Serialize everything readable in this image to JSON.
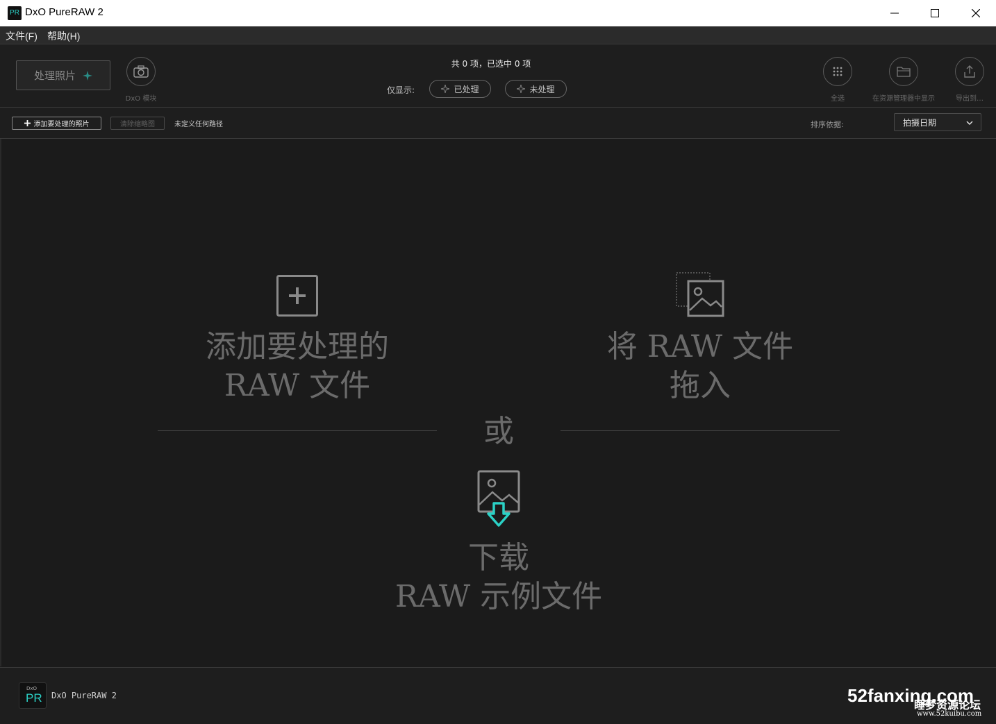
{
  "window": {
    "icon_text": "PR",
    "title": "DxO PureRAW 2"
  },
  "menu": [
    {
      "label": "文件(F)"
    },
    {
      "label": "帮助(H)"
    }
  ],
  "toolbar": {
    "process_label": "处理照片",
    "module_label": "DxO 模块",
    "count_text": "共 0 项，已选中 0 项",
    "filter_label": "仅显示:",
    "filter_processed": "已处理",
    "filter_unprocessed": "未处理",
    "select_all_label": "全选",
    "show_in_explorer_label": "在资源管理器中显示",
    "export_label": "导出到…"
  },
  "secondary": {
    "add_label": "添加要处理的照片",
    "clear_label": "清除缩略图",
    "path_text": "未定义任何路径",
    "sort_label": "排序依据:",
    "sort_value": "拍摄日期"
  },
  "main": {
    "add_text": "添加要处理的\nRAW 文件",
    "drag_text": "将 RAW 文件\n拖入",
    "or_text": "或",
    "download_text": "下载\nRAW 示例文件"
  },
  "footer": {
    "logo_small": "DxO",
    "logo_text": "PR",
    "app_name": "DxO PureRAW 2",
    "watermark": "52fanxing.com",
    "watermark_cn": "睡梦资源论坛",
    "watermark_url": "www.52kuibu.com"
  },
  "colors": {
    "accent": "#2bd1c6",
    "background": "#1b1b1b",
    "muted_text": "#6b6b6b"
  }
}
